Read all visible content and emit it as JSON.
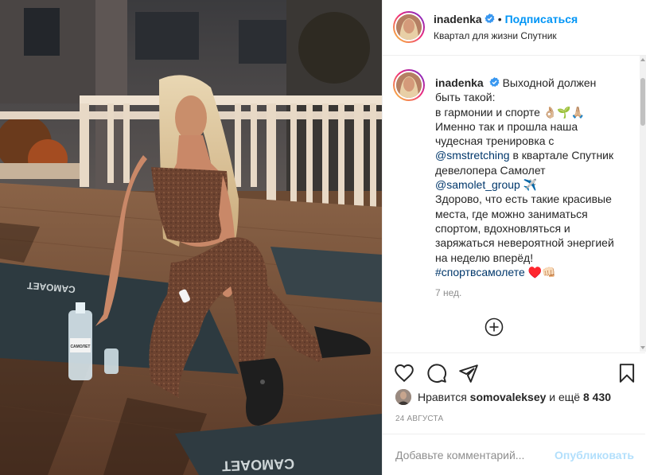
{
  "post": {
    "author": "inadenka",
    "follow_label": "Подписаться",
    "separator": "•",
    "location": "Квартал для жизни Спутник",
    "caption": {
      "author": "inadenka",
      "line1": "Выходной должен быть такой:",
      "line2": "в гармонии и спорте 👌🏼🌱🙏🏼",
      "line3_pre": "Именно так и прошла наша чудесная тренировка с ",
      "mention1": "@smstretching",
      "line3_post": " в квартале Спутник девелопера Самолет ",
      "mention2": "@samolet_group",
      "line3_emoji": " ✈️",
      "line4": "Здорово, что есть такие красивые места, где можно заниматься спортом, вдохновляться и заряжаться невероятной энергией на неделю вперёд!",
      "hashtag": "#спортвсамолете",
      "hashtag_emoji": " ♥️👊🏻"
    },
    "time_ago": "7 нед.",
    "likes": {
      "prefix": "Нравится ",
      "user": "somovaleksey",
      "middle": " и ещё ",
      "count": "8 430"
    },
    "date": "24 августа",
    "comment": {
      "placeholder": "Добавьте комментарий...",
      "value": "",
      "publish_label": "Опубликовать"
    },
    "icons": {
      "like": "heart-icon",
      "comment": "comment-icon",
      "share": "paper-plane-icon",
      "save": "bookmark-icon",
      "more_comments": "plus-circle-icon",
      "verified": "verified-badge-icon"
    },
    "colors": {
      "link": "#0095f6",
      "mention": "#00376b",
      "muted": "#8e8e8e",
      "verified": "#3897f0",
      "publish_disabled": "#b2dffc"
    }
  },
  "photo": {
    "mat_text_top": "CAMOAET",
    "bottle_label": "САМОЛЕТ",
    "mat_text_bottom": "CAMOAET"
  }
}
